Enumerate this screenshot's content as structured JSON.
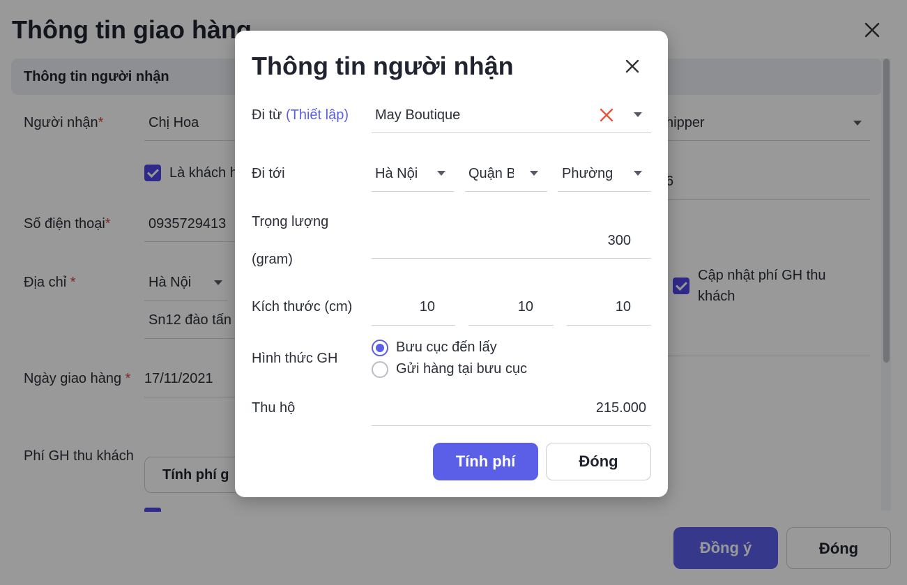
{
  "background": {
    "title": "Thông tin giao hàng",
    "section_title": "Thông tin người nhận",
    "recipient_label": "Người nhận",
    "recipient_value": "Chị Hoa",
    "shipper_value": "hipper",
    "is_customer_label": "Là khách h",
    "right_field_value": "6",
    "phone_label": "Số điện thoại",
    "phone_value": "0935729413",
    "address_label": "Địa chỉ",
    "address_city": "Hà Nội",
    "address_street": "Sn12 đào tấn",
    "update_fee_label_1": "Cập nhật phí GH thu",
    "update_fee_label_2": "khách",
    "date_label": "Ngày giao hàng",
    "date_value": "17/11/2021",
    "fee_label": "Phí GH thu khách",
    "calc_fee_button": "Tính phí g",
    "agree_button": "Đồng ý",
    "close_button": "Đóng",
    "required_mark": "*"
  },
  "modal": {
    "title": "Thông tin người nhận",
    "from_label": "Đi từ",
    "from_link": "(Thiết lập)",
    "from_value": "May Boutique",
    "to_label": "Đi tới",
    "to_city": "Hà Nội",
    "to_district": "Quận B",
    "to_ward": "Phường",
    "weight_label_1": "Trọng lượng",
    "weight_label_2": "(gram)",
    "weight_value": "300",
    "size_label": "Kích thước (cm)",
    "size_l": "10",
    "size_w": "10",
    "size_h": "10",
    "method_label": "Hình thức GH",
    "method_options": [
      "Bưu cục đến lấy",
      "Gửi hàng tại bưu cục"
    ],
    "method_selected": "Bưu cục đến lấy",
    "cod_label": "Thu hộ",
    "cod_value": "215.000",
    "calc_button": "Tính phí",
    "close_button": "Đóng"
  },
  "colors": {
    "accent": "#5b5fe8",
    "required": "#d6463a",
    "clear": "#e8553a"
  }
}
